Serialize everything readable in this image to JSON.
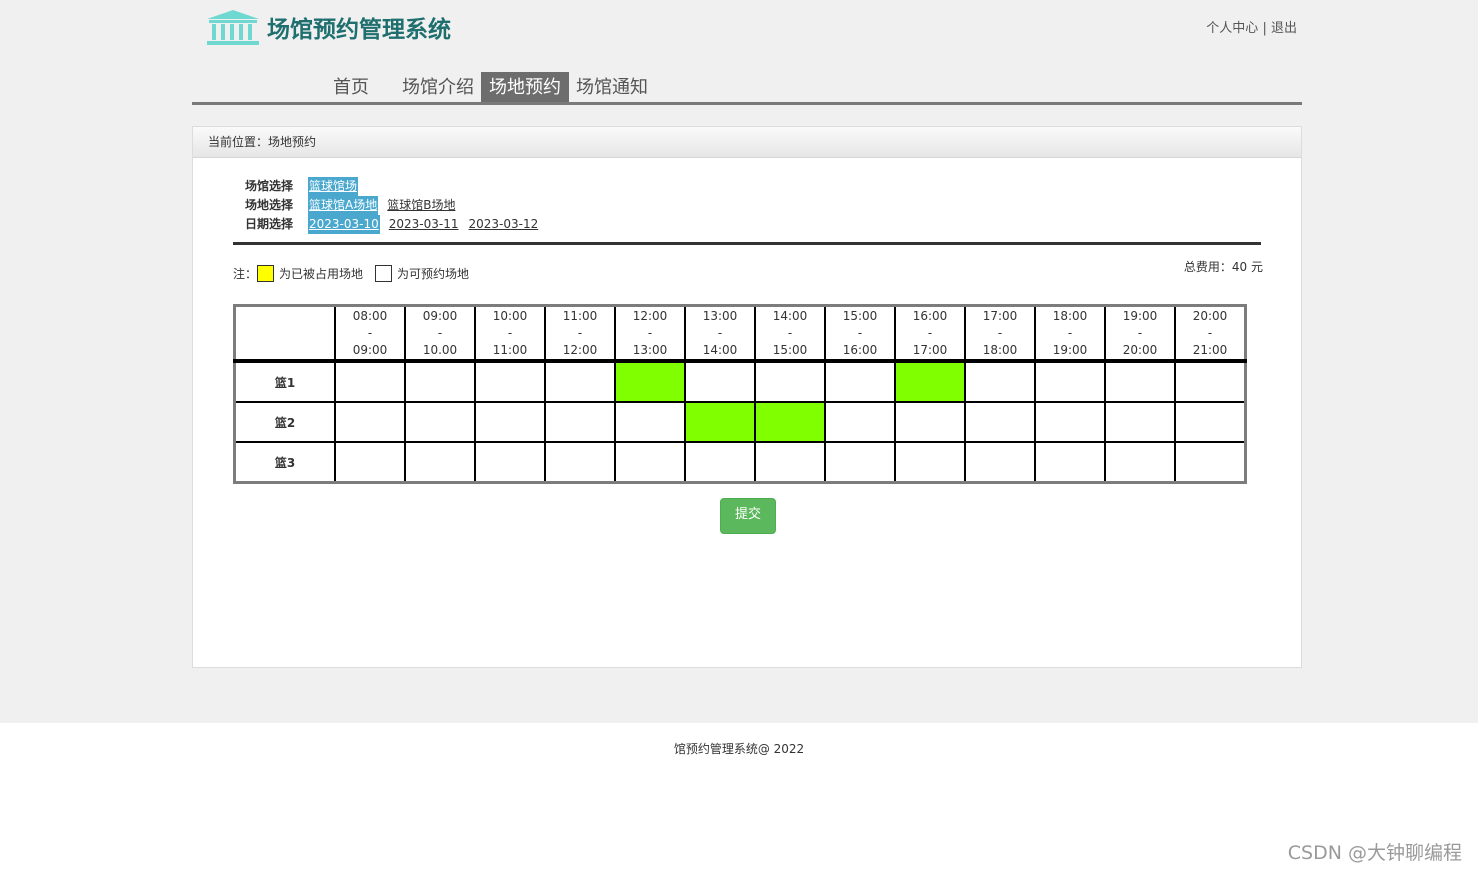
{
  "header": {
    "logo_text": "场馆预约管理系统",
    "user_center": "个人中心",
    "divider": "|",
    "logout": "退出"
  },
  "nav": [
    {
      "label": "首页",
      "active": false
    },
    {
      "label": "场馆介绍",
      "active": false
    },
    {
      "label": "场地预约",
      "active": true
    },
    {
      "label": "场馆通知",
      "active": false
    }
  ],
  "breadcrumb": "当前位置：场地预约",
  "filters": {
    "venue_label": "场馆选择",
    "venues": [
      {
        "label": "篮球馆场",
        "selected": true
      }
    ],
    "field_label": "场地选择",
    "fields": [
      {
        "label": "篮球馆A场地",
        "selected": true
      },
      {
        "label": "篮球馆B场地",
        "selected": false
      }
    ],
    "date_label": "日期选择",
    "dates": [
      {
        "label": "2023-03-10",
        "selected": true
      },
      {
        "label": "2023-03-11",
        "selected": false
      },
      {
        "label": "2023-03-12",
        "selected": false
      }
    ]
  },
  "legend": {
    "prefix": "注：",
    "occupied": "为已被占用场地",
    "available": "为可预约场地"
  },
  "total": "总费用：40 元",
  "schedule": {
    "slots": [
      {
        "start": "08:00",
        "end": "09:00"
      },
      {
        "start": "09:00",
        "end": "10.00"
      },
      {
        "start": "10:00",
        "end": "11:00"
      },
      {
        "start": "11:00",
        "end": "12:00"
      },
      {
        "start": "12:00",
        "end": "13:00"
      },
      {
        "start": "13:00",
        "end": "14:00"
      },
      {
        "start": "14:00",
        "end": "15:00"
      },
      {
        "start": "15:00",
        "end": "16:00"
      },
      {
        "start": "16:00",
        "end": "17:00"
      },
      {
        "start": "17:00",
        "end": "18:00"
      },
      {
        "start": "18:00",
        "end": "19:00"
      },
      {
        "start": "19:00",
        "end": "20:00"
      },
      {
        "start": "20:00",
        "end": "21:00"
      }
    ],
    "dash": "-",
    "courts": [
      {
        "name": "篮1",
        "booked": [
          4,
          8
        ]
      },
      {
        "name": "篮2",
        "booked": [
          5,
          6
        ]
      },
      {
        "name": "篮3",
        "booked": []
      }
    ],
    "booked_color": "#80ff00",
    "occupied_color": "#ffff00"
  },
  "submit_label": "提交",
  "footer": "馆预约管理系统@ 2022",
  "watermark": "CSDN @大钟聊编程"
}
